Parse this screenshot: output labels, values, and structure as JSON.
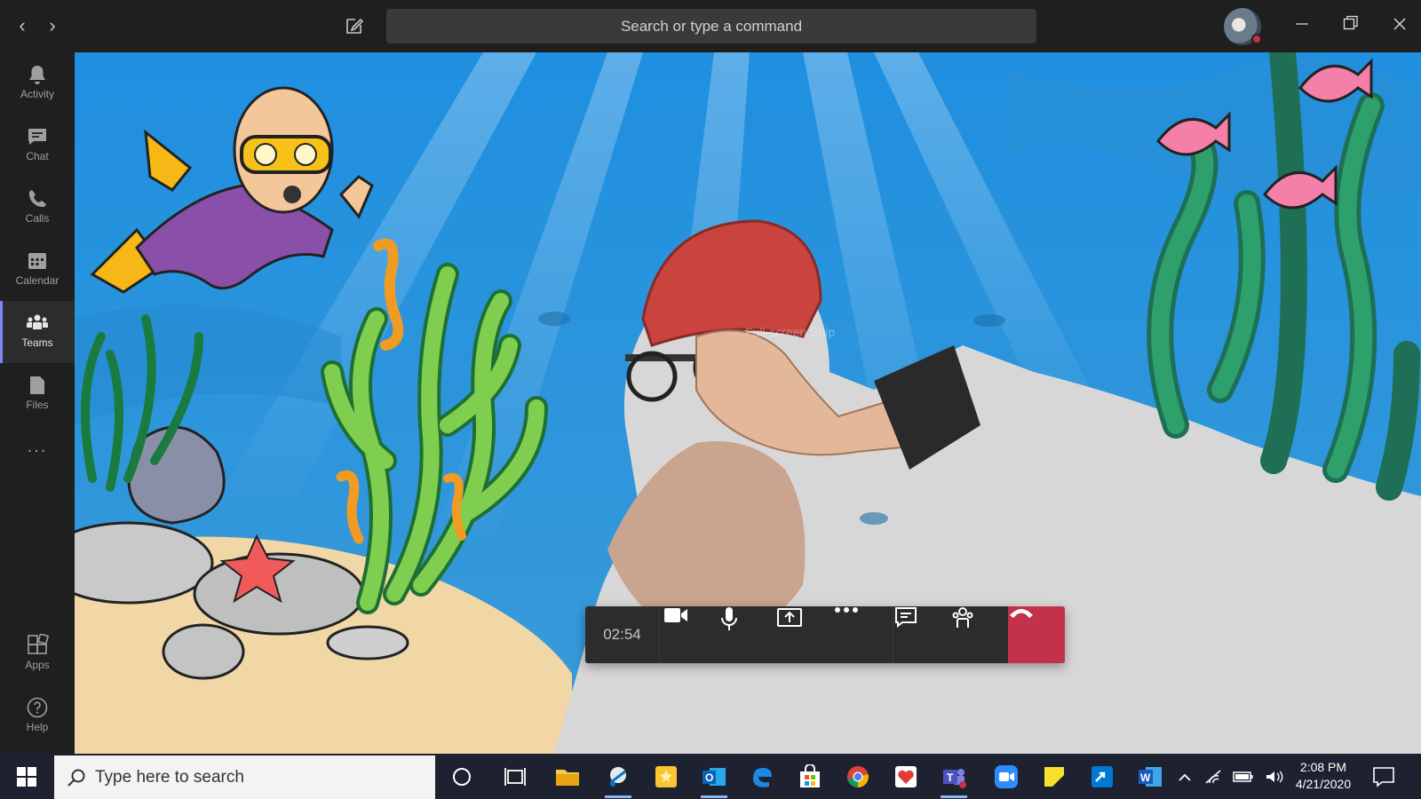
{
  "titlebar": {
    "search_placeholder": "Search or type a command",
    "window_buttons": [
      "minimize",
      "restore",
      "close"
    ]
  },
  "rail": {
    "items": [
      {
        "label": "Activity",
        "icon": "bell-icon"
      },
      {
        "label": "Chat",
        "icon": "chat-icon"
      },
      {
        "label": "Calls",
        "icon": "phone-icon"
      },
      {
        "label": "Calendar",
        "icon": "calendar-icon"
      },
      {
        "label": "Teams",
        "icon": "teams-icon",
        "active": true
      },
      {
        "label": "Files",
        "icon": "file-icon"
      }
    ],
    "more": "...",
    "bottom": [
      {
        "label": "Apps",
        "icon": "apps-icon"
      },
      {
        "label": "Help",
        "icon": "help-icon"
      }
    ]
  },
  "stage": {
    "overlay_hint": "Full-screen Snip"
  },
  "call": {
    "timer": "02:54",
    "buttons": [
      "camera-icon",
      "microphone-icon",
      "share-screen-icon",
      "more-options-icon",
      "chat-icon",
      "participants-icon",
      "hang-up-icon"
    ],
    "hangup_color": "#c4314b"
  },
  "taskbar": {
    "search_placeholder": "Type here to search",
    "apps": [
      "cortana",
      "task-view",
      "file-explorer",
      "snip-sketch",
      "sticky-notes",
      "outlook",
      "edge",
      "store",
      "chrome",
      "health-app",
      "teams",
      "zoom",
      "sticky-notes-2",
      "remote-desktop",
      "word"
    ],
    "time": "2:08 PM",
    "date": "4/21/2020"
  },
  "colors": {
    "accent": "#7f85f5",
    "titlebar": "#201f1f",
    "taskbar": "#1e2230"
  }
}
